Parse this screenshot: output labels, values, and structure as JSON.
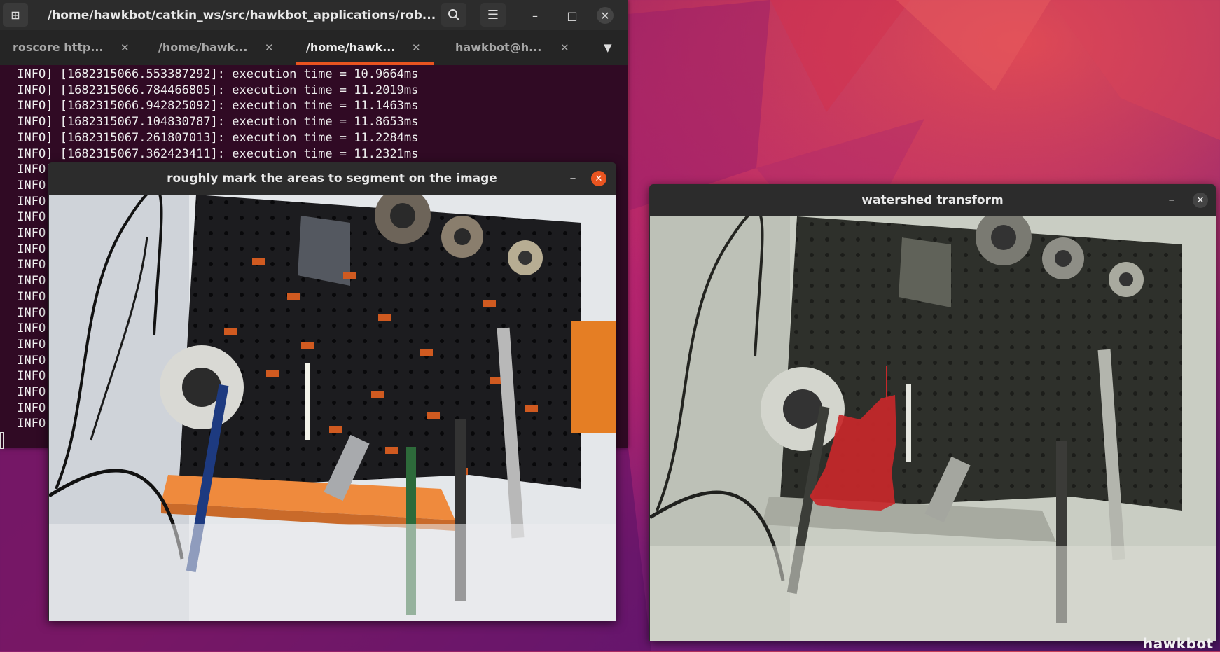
{
  "terminal": {
    "title": "/home/hawkbot/catkin_ws/src/hawkbot_applications/rob...",
    "tabs": [
      {
        "label": "roscore http..."
      },
      {
        "label": "/home/hawk..."
      },
      {
        "label": "/home/hawk..."
      },
      {
        "label": "hawkbot@h..."
      }
    ],
    "active_tab": 2,
    "lines": [
      " INFO] [1682315066.553387292]: execution time = 10.9664ms",
      " INFO] [1682315066.784466805]: execution time = 11.2019ms",
      " INFO] [1682315066.942825092]: execution time = 11.1463ms",
      " INFO] [1682315067.104830787]: execution time = 11.8653ms",
      " INFO] [1682315067.261807013]: execution time = 11.2284ms",
      " INFO] [1682315067.362423411]: execution time = 11.2321ms",
      " INFO]",
      " INFO]",
      " INFO]",
      " INFO]",
      " INFO]",
      " INFO]",
      " INFO]",
      " INFO]",
      " INFO]",
      " INFO]",
      " INFO]",
      " INFO]",
      " INFO]",
      " INFO]",
      " INFO]",
      " INFO]",
      " INFO]"
    ],
    "icons": {
      "new_tab": "new-tab-icon",
      "search": "search-icon",
      "menu": "hamburger-menu-icon",
      "minimize": "minimize-icon",
      "maximize": "maximize-icon",
      "close": "close-icon",
      "tab_list": "chevron-down-icon"
    }
  },
  "mark_window": {
    "title": "roughly mark the areas to segment on the image",
    "close_color": "#e95420"
  },
  "watershed_window": {
    "title": "watershed transform",
    "segment_color": "#c8282a"
  },
  "watermark": "hawkbot",
  "colors": {
    "terminal_bg": "#300a24",
    "accent": "#e95420",
    "header": "#2c2c2c"
  }
}
